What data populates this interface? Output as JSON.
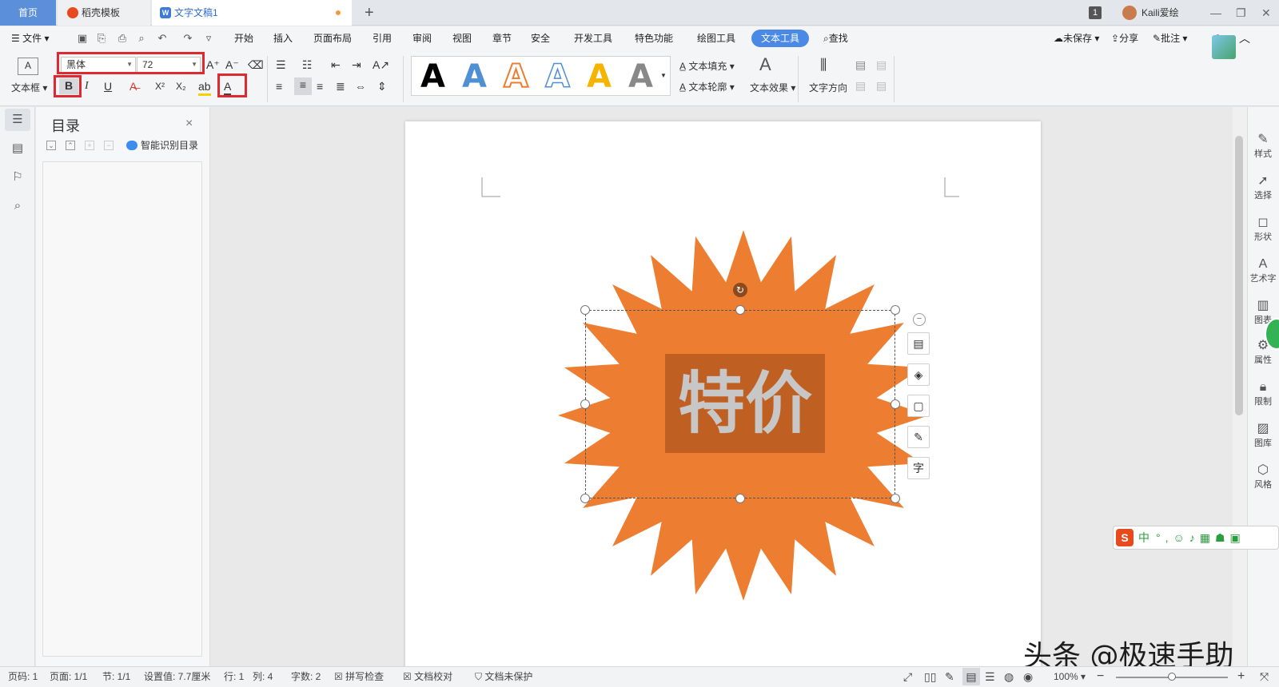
{
  "tabs": {
    "home": "首页",
    "template": "稻壳模板",
    "document": "文字文稿1",
    "add": "+"
  },
  "titlebar": {
    "page_badge": "1",
    "username": "Kaili爱绘",
    "minimize": "—",
    "restore": "❐",
    "close": "✕"
  },
  "menu": {
    "file": "文件",
    "items": [
      "开始",
      "插入",
      "页面布局",
      "引用",
      "审阅",
      "视图",
      "章节",
      "安全",
      "开发工具",
      "特色功能",
      "绘图工具",
      "文本工具"
    ],
    "search": "查找",
    "unsaved": "未保存",
    "share": "分享",
    "comment": "批注"
  },
  "ribbon": {
    "textbox_label": "文本框",
    "font_name": "黑体",
    "font_size": "72",
    "bold": "B",
    "italic": "I",
    "underline": "U",
    "superscript": "X²",
    "subscript": "X₂",
    "style_letters": [
      "A",
      "A",
      "A",
      "A",
      "A",
      "A"
    ],
    "text_fill": "文本填充",
    "text_outline": "文本轮廓",
    "text_effect": "文本效果",
    "text_direction": "文字方向"
  },
  "toc": {
    "title": "目录",
    "close": "×",
    "smart": "智能识别目录"
  },
  "document": {
    "shape_text": "特价"
  },
  "right_panel": [
    "样式",
    "选择",
    "形状",
    "艺术字",
    "图表",
    "属性",
    "限制",
    "图库",
    "风格"
  ],
  "status": {
    "page_code": "页码: 1",
    "page": "页面: 1/1",
    "section": "节: 1/1",
    "setting": "设置值: 7.7厘米",
    "row": "行: 1",
    "col": "列: 4",
    "words": "字数: 2",
    "spell": "拼写检查",
    "proof": "文档校对",
    "protect": "文档未保护",
    "zoom": "100%"
  },
  "watermark": "头条 @极速手助",
  "ime": {
    "lang": "中"
  },
  "colors": {
    "accent": "#4a8ae6",
    "star": "#ed7d31",
    "highlight_box": "#e0282f",
    "shape_text": "#c7c7c7",
    "text_bg": "#bf5f22"
  }
}
